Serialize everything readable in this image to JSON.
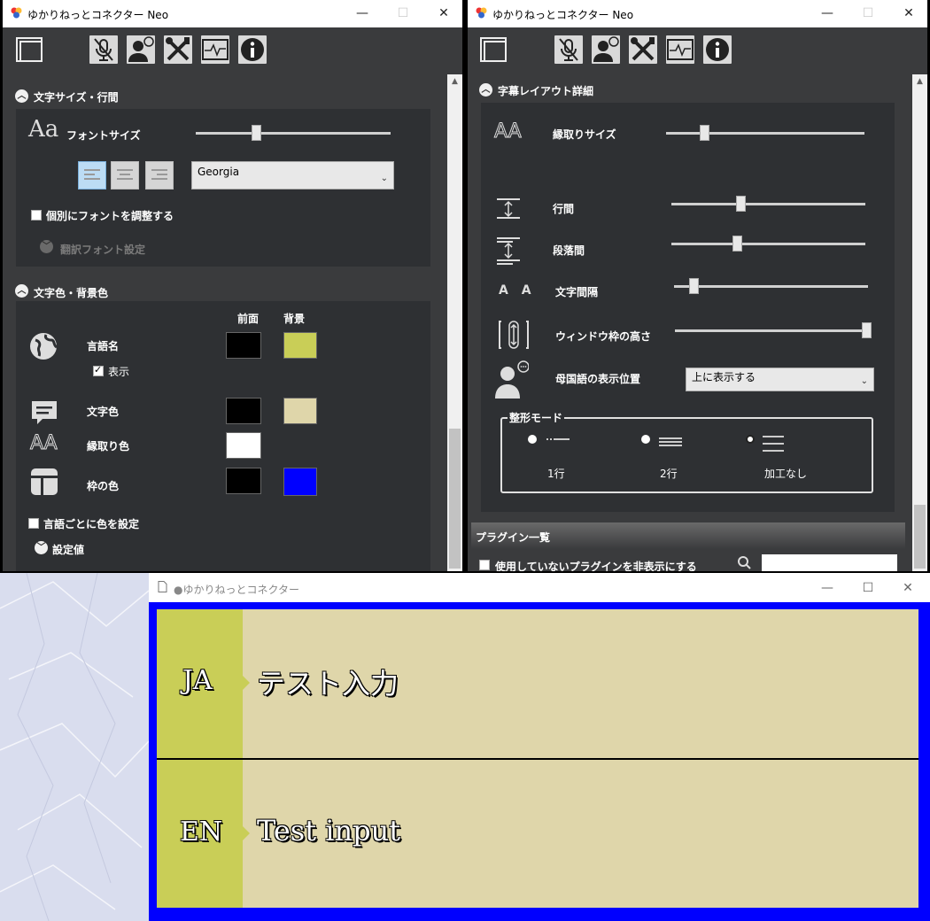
{
  "left_window": {
    "title": "ゆかりねっとコネクター Neo",
    "section1": {
      "title": "文字サイズ・行間",
      "font_size_label": "フォントサイズ",
      "font_size_value": 0.3,
      "font_select": "Georgia",
      "individual_font_label": "個別にフォントを調整する",
      "translation_font_label": "翻訳フォント設定"
    },
    "section2": {
      "title": "文字色・背景色",
      "col_front": "前面",
      "col_back": "背景",
      "rows": [
        {
          "label": "言語名",
          "front": "#000000",
          "back": "#c9ce57"
        },
        {
          "label": "文字色",
          "front": "#000000",
          "back": "#dfd6aa"
        },
        {
          "label": "縁取り色",
          "front": "#ffffff"
        },
        {
          "label": "枠の色",
          "front": "#000000",
          "back": "#0000ff"
        }
      ],
      "show_label": "表示",
      "per_language_label": "言語ごとに色を設定",
      "settings_value_label": "設定値"
    }
  },
  "right_window": {
    "title": "ゆかりねっとコネクター Neo",
    "section": {
      "title": "字幕レイアウト詳細",
      "rows": [
        {
          "label": "縁取りサイズ",
          "value": 0.18
        },
        {
          "label": "行間",
          "value": 0.35
        },
        {
          "label": "段落間",
          "value": 0.33
        },
        {
          "label": "文字間隔",
          "value": 0.08
        },
        {
          "label": "ウィンドウ枠の高さ",
          "value": 1.0
        }
      ],
      "native_position_label": "母国語の表示位置",
      "native_position_select": "上に表示する",
      "shaping_mode_title": "整形モード",
      "modes": [
        "1行",
        "2行",
        "加工なし"
      ]
    },
    "plugins": {
      "title": "プラグイン一覧",
      "hide_unused_label": "使用していないプラグインを非表示にする"
    }
  },
  "subtitle_window": {
    "title": "●ゆかりねっとコネクター",
    "rows": [
      {
        "lang": "JA",
        "text": "テスト入力"
      },
      {
        "lang": "EN",
        "text": "Test input"
      }
    ]
  },
  "colors": {
    "lang_bg": "#c9ce57",
    "text_bg": "#dfd6aa",
    "frame": "#0000ff",
    "panel_bg": "#2e3033",
    "window_bg": "#3a3b3d"
  }
}
